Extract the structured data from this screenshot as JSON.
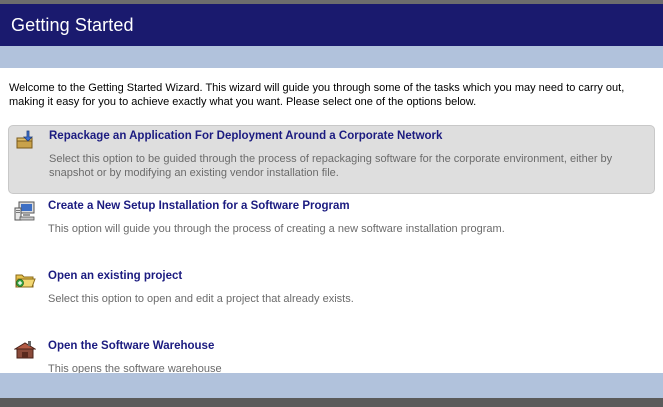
{
  "header": {
    "title": "Getting Started"
  },
  "intro": {
    "text": "Welcome to the Getting Started Wizard. This wizard will guide you through some of the tasks which you may need to carry out, making it easy for you to achieve exactly what you want. Please select one of the options below."
  },
  "options": [
    {
      "title": "Repackage an Application For Deployment Around a Corporate Network",
      "description": "Select this option to be guided through the process of repackaging software for the corporate environment, either by snapshot or by modifying an existing vendor installation file.",
      "icon": "repackage-icon",
      "selected": true
    },
    {
      "title": "Create a New Setup Installation for a Software Program",
      "description": "This option will guide you through the process of creating a new software installation program.",
      "icon": "computer-setup-icon",
      "selected": false
    },
    {
      "title": "Open an existing project",
      "description": "Select this option to open and edit a project that already exists.",
      "icon": "open-folder-icon",
      "selected": false
    },
    {
      "title": "Open the Software Warehouse",
      "description": "This opens the software warehouse",
      "icon": "warehouse-icon",
      "selected": false
    }
  ],
  "colors": {
    "header_bg": "#1a1a6e",
    "stripe_bg": "#b1c2dc",
    "title_color": "#1b1b80",
    "desc_color": "#6b6b6b",
    "selected_bg": "#dedede"
  }
}
